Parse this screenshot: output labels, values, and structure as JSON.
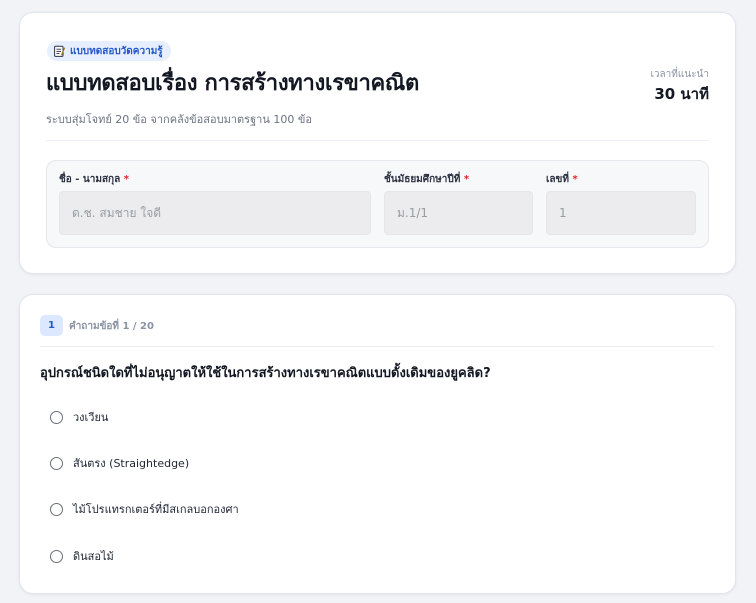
{
  "header": {
    "badge": "แบบทดสอบวัดความรู้",
    "badge_icon": "note-icon",
    "title": "แบบทดสอบเรื่อง การสร้างทางเรขาคณิต",
    "subtitle": "ระบบสุ่มโจทย์ 20 ข้อ จากคลังข้อสอบมาตรฐาน 100 ข้อ",
    "time_label": "เวลาที่แนะนำ",
    "time_value": "30 นาที"
  },
  "form": {
    "name": {
      "label": "ชื่อ - นามสกุล",
      "placeholder": "ด.ช. สมชาย ใจดี",
      "value": ""
    },
    "class": {
      "label": "ชั้นมัธยมศึกษาปีที่",
      "placeholder": "ม.1/1",
      "value": ""
    },
    "number": {
      "label": "เลขที่",
      "placeholder": "1",
      "value": ""
    },
    "required_mark": "*"
  },
  "question": {
    "number": "1",
    "counter": "คำถามข้อที่ 1 / 20",
    "text": "อุปกรณ์ชนิดใดที่ไม่อนุญาตให้ใช้ในการสร้างทางเรขาคณิตแบบดั้งเดิมของยูคลิด?",
    "options": [
      "วงเวียน",
      "สันตรง (Straightedge)",
      "ไม้โปรแทรกเตอร์ที่มีสเกลบอกองศา",
      "ดินสอไม้"
    ]
  },
  "colors": {
    "accent": "#2456c7",
    "accent_bg": "#e7efff",
    "required": "#dc2626",
    "page_bg": "#f1f3f6"
  }
}
